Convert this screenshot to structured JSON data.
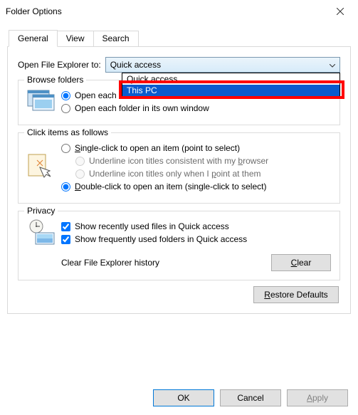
{
  "window": {
    "title": "Folder Options"
  },
  "tabs": [
    {
      "label": "General",
      "active": true
    },
    {
      "label": "View",
      "active": false
    },
    {
      "label": "Search",
      "active": false
    }
  ],
  "openExplorer": {
    "label": "Open File Explorer to:",
    "selected": "Quick access",
    "options": [
      "Quick access",
      "This PC"
    ],
    "highlightedIndex": 1
  },
  "browse": {
    "title": "Browse folders",
    "opt1": "Open each folder in the same window",
    "opt2": "Open each folder in its own window",
    "selected": 0
  },
  "click": {
    "title": "Click items as follows",
    "single": "Single-click to open an item (point to select)",
    "underline1": "Underline icon titles consistent with my browser",
    "underline2": "Underline icon titles only when I point at them",
    "double": "Double-click to open an item (single-click to select)",
    "selected": "double"
  },
  "privacy": {
    "title": "Privacy",
    "recent": "Show recently used files in Quick access",
    "frequent": "Show frequently used folders in Quick access",
    "recentChecked": true,
    "frequentChecked": true,
    "clearLabel": "Clear File Explorer history",
    "clearBtn": "Clear"
  },
  "restore": "Restore Defaults",
  "buttons": {
    "ok": "OK",
    "cancel": "Cancel",
    "apply": "Apply"
  }
}
